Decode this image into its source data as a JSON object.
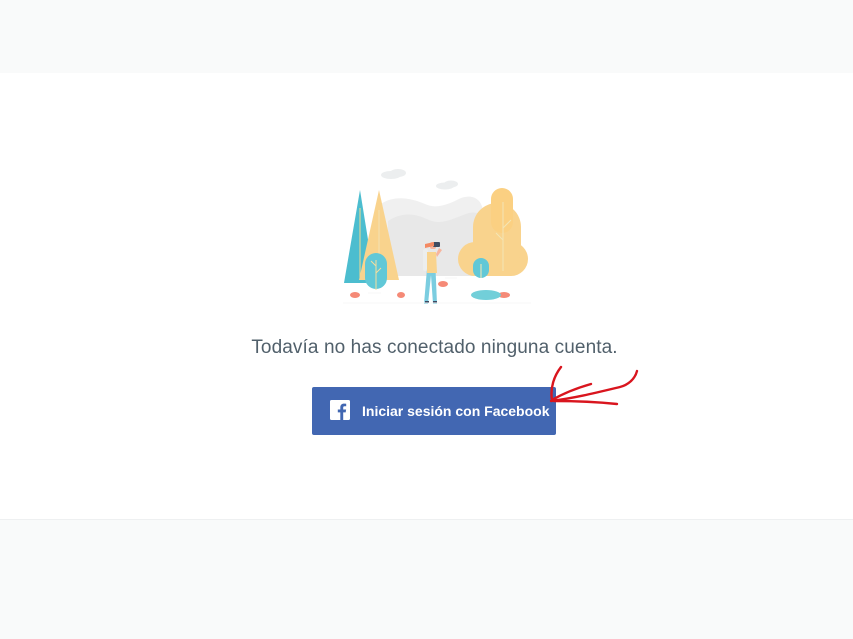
{
  "empty_state": {
    "message": "Todavía no has conectado ninguna cuenta.",
    "illustration_icon": "explorer-binoculars-landscape-illustration"
  },
  "login_button": {
    "label": "Iniciar sesión con Facebook",
    "icon": "facebook-icon",
    "color": "#4267b2"
  },
  "annotation": {
    "icon": "red-arrow-annotation",
    "color": "#d9151e"
  },
  "colors": {
    "background": "#f9fafa",
    "card": "#ffffff",
    "text": "#51606b"
  }
}
